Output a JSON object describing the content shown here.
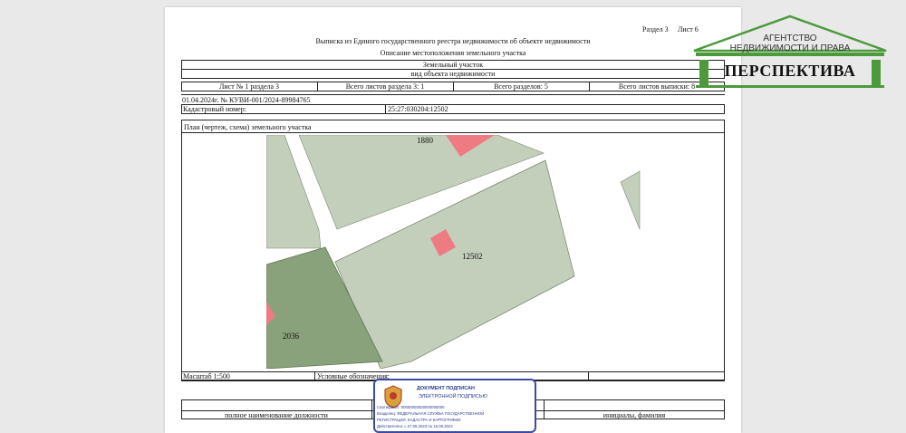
{
  "header": {
    "section": "Раздел 3",
    "sheet": "Лист 6",
    "title": "Выписка из Единого государственного реестра недвижимости об объекте недвижимости",
    "subtitle": "Описание местоположения земельного участка",
    "object_type": "Земельный участок",
    "object_type_caption": "вид объекта недвижимости"
  },
  "counts": {
    "sheet_no": "Лист № 1 раздела 3",
    "total_sheets_section": "Всего листов раздела 3: 1",
    "total_sections": "Всего разделов: 5",
    "total_sheets_extract": "Всего листов выписки: 8"
  },
  "record": {
    "date_number": "01.04.2024г. № КУВИ-001/2024-89984765",
    "cadastral_label": "Кадастровый номер:",
    "cadastral_value": "25:27:030204:12502"
  },
  "plan": {
    "caption": "План (чертеж, схема) земельного участка",
    "labels": [
      "1880",
      "12502",
      "2036"
    ],
    "colors": {
      "parcel": "#c4cfbb",
      "dark_parcel": "#8aa27c",
      "building": "#ef7b82",
      "road": "#ffffff"
    }
  },
  "footer": {
    "scale": "Масштаб 1:500",
    "legend": "Условные обозначения:",
    "position_caption": "полное наименование должности",
    "name_caption": "инициалы, фамилия"
  },
  "stamp": {
    "line1": "ДОКУМЕНТ ПОДПИСАН",
    "line2": "ЭЛЕКТРОННОЙ ПОДПИСЬЮ",
    "cert": "Сертификат: 00000000000000000000",
    "owner": "Владелец: ФЕДЕРАЛЬНАЯ СЛУЖБА ГОСУДАРСТВЕННОЙ",
    "owner2": "РЕГИСТРАЦИИ, КАДАСТРА И КАРТОГРАФИИ",
    "valid": "Действителен: с 27.06.2023 по 19.09.2024",
    "border_color": "#3b4aa3"
  },
  "logo": {
    "line1": "АГЕНТСТВО",
    "line2": "НЕДВИЖИМОСТИ И ПРАВА",
    "brand": "ПЕРСПЕКТИВА",
    "color": "#4c9a3b"
  }
}
